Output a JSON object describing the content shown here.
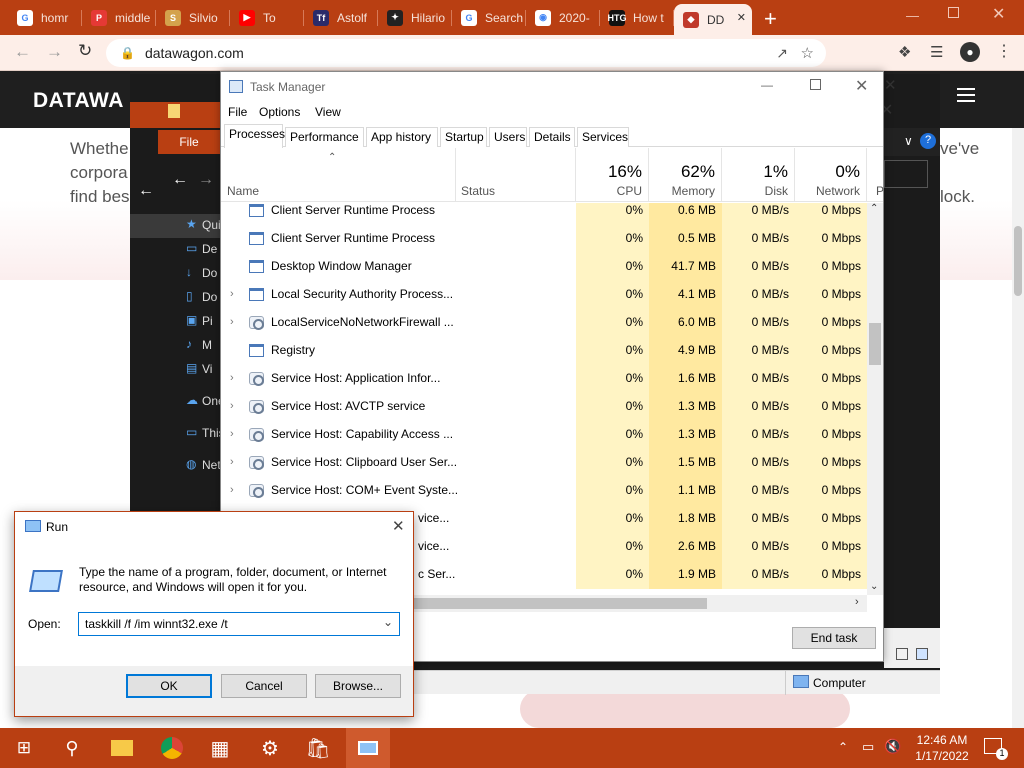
{
  "browser": {
    "tabs": [
      {
        "label": "homr",
        "icon": "google-icon",
        "color": "#ffffff",
        "glyph": "G"
      },
      {
        "label": "middle",
        "icon": "pdf-icon",
        "color": "#e53935",
        "glyph": "P"
      },
      {
        "label": "Silvio",
        "icon": "silvio-icon",
        "color": "#d4a24c",
        "glyph": "S"
      },
      {
        "label": "To",
        "icon": "youtube-icon",
        "color": "#ff0000",
        "glyph": "▶"
      },
      {
        "label": "Astolf",
        "icon": "tm-icon",
        "color": "#2b2b6a",
        "glyph": "Tf"
      },
      {
        "label": "Hilario",
        "icon": "github-icon",
        "color": "#222222",
        "glyph": "✦"
      },
      {
        "label": "Search",
        "icon": "google-icon",
        "color": "#ffffff",
        "glyph": "G"
      },
      {
        "label": "2020-",
        "icon": "globe-icon",
        "color": "#ffffff",
        "glyph": "◉"
      },
      {
        "label": "How t",
        "icon": "htg-icon",
        "color": "#111111",
        "glyph": "HTG"
      },
      {
        "label": "DD",
        "icon": "dw-icon",
        "color": "#c0392b",
        "glyph": "◆"
      }
    ],
    "url": "datawagon.com"
  },
  "site": {
    "logo": "DATAWA",
    "left_text": [
      "Whethe",
      "corpora",
      "find bes"
    ],
    "right_text": [
      "ve've",
      "lock."
    ]
  },
  "explorer": {
    "menu_file": "File",
    "nav_items": [
      "Qui",
      "De",
      "Do",
      "Do",
      "Pi",
      "M",
      "Vi",
      "One",
      "This",
      "Net"
    ]
  },
  "taskmanager": {
    "title": "Task Manager",
    "menu": [
      "File",
      "Options",
      "View"
    ],
    "tabs": [
      "Processes",
      "Performance",
      "App history",
      "Startup",
      "Users",
      "Details",
      "Services"
    ],
    "columns": {
      "name": "Name",
      "status": "Status",
      "cpu": {
        "pct": "16%",
        "label": "CPU"
      },
      "memory": {
        "pct": "62%",
        "label": "Memory"
      },
      "disk": {
        "pct": "1%",
        "label": "Disk"
      },
      "network": {
        "pct": "0%",
        "label": "Network"
      },
      "power": "P"
    },
    "rows": [
      {
        "name": "Client Server Runtime Process",
        "expand": false,
        "icon": "window",
        "cpu": "0%",
        "mem": "0.6 MB",
        "disk": "0 MB/s",
        "net": "0 Mbps"
      },
      {
        "name": "Client Server Runtime Process",
        "expand": false,
        "icon": "window",
        "cpu": "0%",
        "mem": "0.5 MB",
        "disk": "0 MB/s",
        "net": "0 Mbps"
      },
      {
        "name": "Desktop Window Manager",
        "expand": false,
        "icon": "window",
        "cpu": "0%",
        "mem": "41.7 MB",
        "disk": "0 MB/s",
        "net": "0 Mbps"
      },
      {
        "name": "Local Security Authority Process...",
        "expand": true,
        "icon": "window",
        "cpu": "0%",
        "mem": "4.1 MB",
        "disk": "0 MB/s",
        "net": "0 Mbps"
      },
      {
        "name": "LocalServiceNoNetworkFirewall ...",
        "expand": true,
        "icon": "gear",
        "cpu": "0%",
        "mem": "6.0 MB",
        "disk": "0 MB/s",
        "net": "0 Mbps"
      },
      {
        "name": "Registry",
        "expand": false,
        "icon": "window",
        "cpu": "0%",
        "mem": "4.9 MB",
        "disk": "0 MB/s",
        "net": "0 Mbps"
      },
      {
        "name": "Service Host: Application Infor...",
        "expand": true,
        "icon": "gear",
        "cpu": "0%",
        "mem": "1.6 MB",
        "disk": "0 MB/s",
        "net": "0 Mbps"
      },
      {
        "name": "Service Host: AVCTP service",
        "expand": true,
        "icon": "gear",
        "cpu": "0%",
        "mem": "1.3 MB",
        "disk": "0 MB/s",
        "net": "0 Mbps"
      },
      {
        "name": "Service Host: Capability Access ...",
        "expand": true,
        "icon": "gear",
        "cpu": "0%",
        "mem": "1.3 MB",
        "disk": "0 MB/s",
        "net": "0 Mbps"
      },
      {
        "name": "Service Host: Clipboard User Ser...",
        "expand": true,
        "icon": "gear",
        "cpu": "0%",
        "mem": "1.5 MB",
        "disk": "0 MB/s",
        "net": "0 Mbps"
      },
      {
        "name": "Service Host: COM+ Event Syste...",
        "expand": true,
        "icon": "gear",
        "cpu": "0%",
        "mem": "1.1 MB",
        "disk": "0 MB/s",
        "net": "0 Mbps"
      },
      {
        "name": "vice...",
        "expand": false,
        "icon": "none",
        "cpu": "0%",
        "mem": "1.8 MB",
        "disk": "0 MB/s",
        "net": "0 Mbps"
      },
      {
        "name": "vice...",
        "expand": false,
        "icon": "none",
        "cpu": "0%",
        "mem": "2.6 MB",
        "disk": "0 MB/s",
        "net": "0 Mbps"
      },
      {
        "name": "c Ser...",
        "expand": false,
        "icon": "none",
        "cpu": "0%",
        "mem": "1.9 MB",
        "disk": "0 MB/s",
        "net": "0 Mbps"
      }
    ],
    "end_task": "End task"
  },
  "explorer_status": {
    "computer": "Computer"
  },
  "run": {
    "title": "Run",
    "desc": "Type the name of a program, folder, document, or Internet resource, and Windows will open it for you.",
    "open_label": "Open:",
    "input_value": "taskkill /f /im winnt32.exe /t",
    "ok": "OK",
    "cancel": "Cancel",
    "browse": "Browse..."
  },
  "taskbar": {
    "time": "12:46 AM",
    "date": "1/17/2022",
    "notification_count": "1"
  },
  "colors": {
    "accent": "#b93f12",
    "chrome_bg": "#fdeee8",
    "cpu_cell": "#fff4c4",
    "mem_cell": "#ffe9a0"
  }
}
